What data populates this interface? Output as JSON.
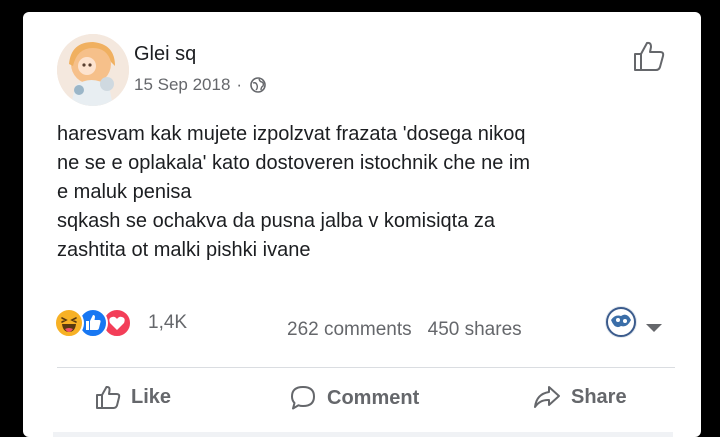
{
  "post": {
    "author": "Glei sq",
    "date": "15 Sep 2018",
    "separator": "·",
    "privacy_icon": "globe-icon",
    "text_lines": [
      "haresvam kak mujete izpolzvat frazata 'dosega nikoq",
      "ne se e oplakala' kato dostoveren istochnik che ne im",
      "e maluk penisa",
      "sqkash se ochakva da pusna jalba v komisiqta za",
      "zashtita ot malki pishki ivane"
    ]
  },
  "reactions": {
    "count": "1,4K",
    "icons": [
      "haha-icon",
      "like-icon",
      "love-icon"
    ]
  },
  "stats": {
    "comments": "262 comments",
    "shares": "450 shares"
  },
  "actions": {
    "like": "Like",
    "comment": "Comment",
    "share": "Share"
  },
  "colors": {
    "text": "#1c1e21",
    "muted": "#65676b",
    "like_blue": "#1877f2",
    "love_red": "#f33e58",
    "haha_yellow": "#f7b125"
  }
}
